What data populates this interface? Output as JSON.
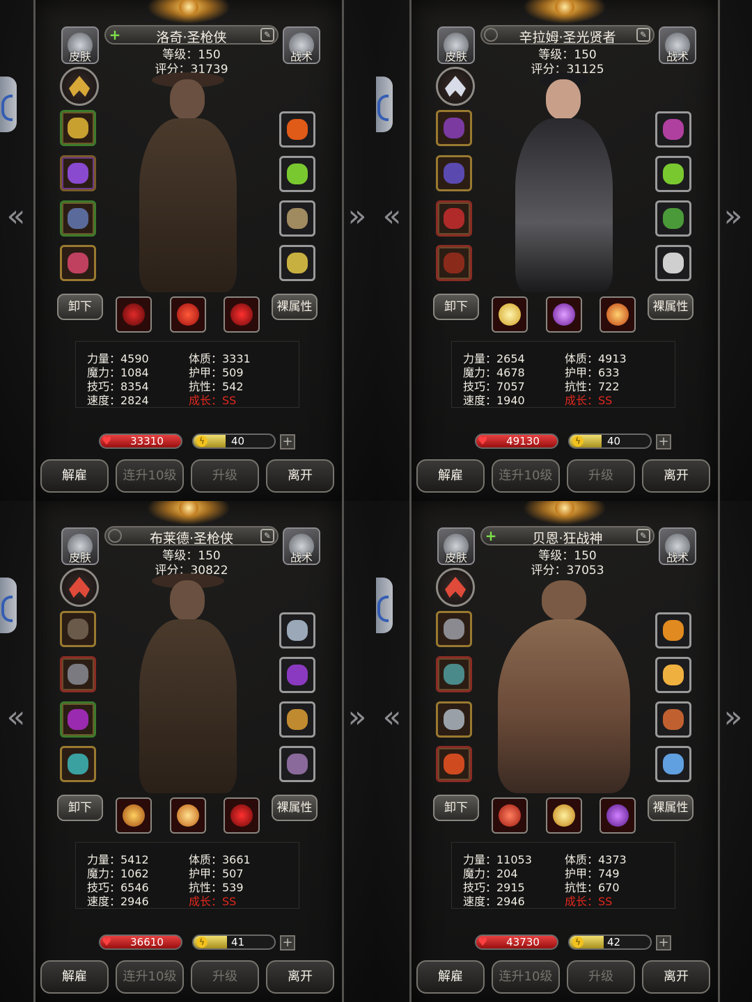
{
  "common": {
    "skin_label": "皮肤",
    "tactics_label": "战术",
    "unequip_label": "卸下",
    "bare_attr_label": "裸属性",
    "dismiss_label": "解雇",
    "level_up10_label": "连升10级",
    "level_up_label": "升级",
    "leave_label": "离开",
    "add_symbol": "+",
    "prev_symbol": "«",
    "next_symbol": "»"
  },
  "heroes": [
    {
      "name": "洛奇·圣枪侠",
      "level": "等级：150",
      "score": "评分：31739",
      "recruit_plus": true,
      "stats": {
        "str": "力量：4590",
        "con": "体质：3331",
        "mag": "魔力：1084",
        "arm": "护甲：509",
        "skl": "技巧：8354",
        "res": "抗性：542",
        "spd": "速度：2824",
        "grow": "成长：SS"
      },
      "hp": "33310",
      "energy": "40",
      "energy_pct": 0.4
    },
    {
      "name": "辛拉姆·圣光贤者",
      "level": "等级：150",
      "score": "评分：31125",
      "recruit_plus": false,
      "stats": {
        "str": "力量：2654",
        "con": "体质：4913",
        "mag": "魔力：4678",
        "arm": "护甲：633",
        "skl": "技巧：7057",
        "res": "抗性：722",
        "spd": "速度：1940",
        "grow": "成长：SS"
      },
      "hp": "49130",
      "energy": "40",
      "energy_pct": 0.4
    },
    {
      "name": "布莱德·圣枪侠",
      "level": "等级：150",
      "score": "评分：30822",
      "recruit_plus": false,
      "stats": {
        "str": "力量：5412",
        "con": "体质：3661",
        "mag": "魔力：1062",
        "arm": "护甲：507",
        "skl": "技巧：6546",
        "res": "抗性：539",
        "spd": "速度：2946",
        "grow": "成长：SS"
      },
      "hp": "36610",
      "energy": "41",
      "energy_pct": 0.41
    },
    {
      "name": "贝恩·狂战神",
      "level": "等级：150",
      "score": "评分：37053",
      "recruit_plus": true,
      "stats": {
        "str": "力量：11053",
        "con": "体质：4373",
        "mag": "魔力：204",
        "arm": "护甲：749",
        "skl": "技巧：2915",
        "res": "抗性：670",
        "spd": "速度：2946",
        "grow": "成长：SS"
      },
      "hp": "43730",
      "energy": "42",
      "energy_pct": 0.42
    }
  ],
  "colors": {
    "growth_red": "#e0281e",
    "hp_red": "#c82020",
    "energy_yellow": "#d8c840",
    "plus_green": "#7ee04a"
  }
}
